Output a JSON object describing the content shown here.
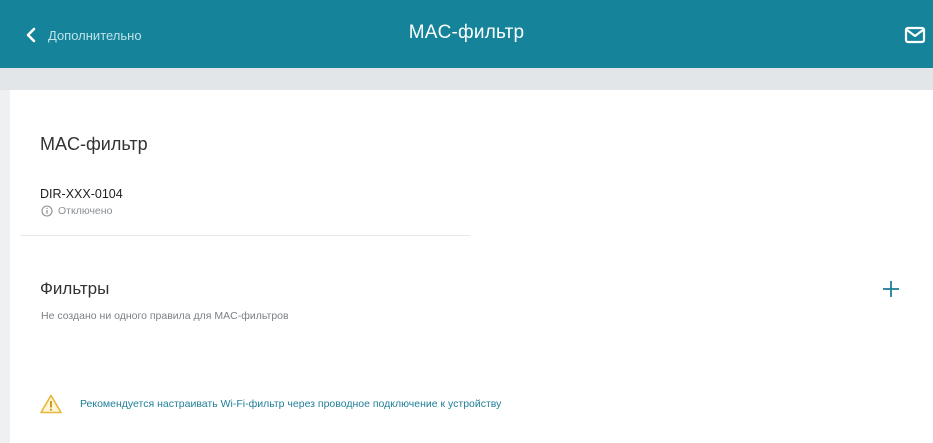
{
  "header": {
    "back_label": "Дополнительно",
    "title": "MAC-фильтр",
    "background_color": "#15839a",
    "back_icon": "chevron-left-icon",
    "mail_icon": "mail-icon"
  },
  "mac_filter": {
    "section_title": "MAC-фильтр",
    "device_name": "DIR-XXX-0104",
    "status_text": "Отключено",
    "status_icon": "info-icon"
  },
  "filters": {
    "title": "Фильтры",
    "empty_text": "Не создано ни одного правила для MAC-фильтров",
    "add_icon": "plus-icon"
  },
  "warning": {
    "text": "Рекомендуется настраивать Wi-Fi-фильтр через проводное подключение к устройству",
    "icon": "warning-triangle-icon",
    "color": "#1f7f98"
  }
}
